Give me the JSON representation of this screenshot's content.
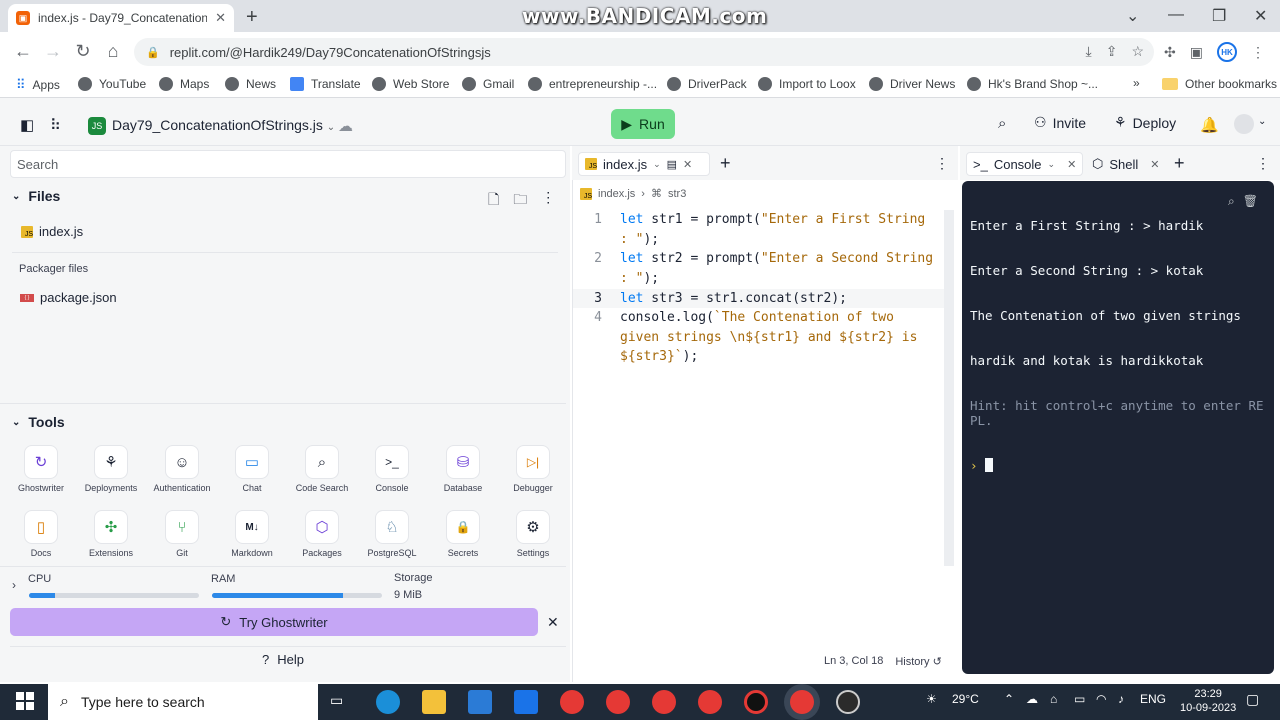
{
  "browser": {
    "tab_title": "index.js - Day79_ConcatenationO",
    "url": "replit.com/@Hardik249/Day79ConcatenationOfStringsjs",
    "watermark": "www.BANDICAM.com",
    "avatar_initials": "HK",
    "bookmarks": [
      {
        "label": "Apps",
        "icon": "apps-grid-icon"
      },
      {
        "label": "YouTube",
        "icon": "globe-icon"
      },
      {
        "label": "Maps",
        "icon": "globe-icon"
      },
      {
        "label": "News",
        "icon": "globe-icon"
      },
      {
        "label": "Translate",
        "icon": "translate-icon"
      },
      {
        "label": "Web Store",
        "icon": "globe-icon"
      },
      {
        "label": "Gmail",
        "icon": "globe-icon"
      },
      {
        "label": "entrepreneurship -...",
        "icon": "globe-icon"
      },
      {
        "label": "DriverPack",
        "icon": "globe-icon"
      },
      {
        "label": "Import to Loox",
        "icon": "globe-icon"
      },
      {
        "label": "Driver News",
        "icon": "globe-icon"
      },
      {
        "label": "Hk's Brand Shop ~...",
        "icon": "globe-icon"
      }
    ],
    "more_bookmarks": "»",
    "other_bookmarks": "Other bookmarks"
  },
  "replit": {
    "repl_name": "Day79_ConcatenationOfStrings.js",
    "run_label": "Run",
    "invite_label": "Invite",
    "deploy_label": "Deploy",
    "search_placeholder": "Search",
    "files_heading": "Files",
    "files": [
      "index.js"
    ],
    "packager_heading": "Packager files",
    "packager_files": [
      "package.json"
    ],
    "tools_heading": "Tools",
    "tools": [
      {
        "label": "Ghostwriter",
        "glyph": "↻"
      },
      {
        "label": "Deployments",
        "glyph": "⚘"
      },
      {
        "label": "Authentication",
        "glyph": "☺"
      },
      {
        "label": "Chat",
        "glyph": "▭"
      },
      {
        "label": "Code Search",
        "glyph": "⌕"
      },
      {
        "label": "Console",
        "glyph": ">_"
      },
      {
        "label": "Database",
        "glyph": "⛁"
      },
      {
        "label": "Debugger",
        "glyph": "▷|"
      },
      {
        "label": "Docs",
        "glyph": "▯"
      },
      {
        "label": "Extensions",
        "glyph": "✣"
      },
      {
        "label": "Git",
        "glyph": "⑂"
      },
      {
        "label": "Markdown",
        "glyph": "M↓"
      },
      {
        "label": "Packages",
        "glyph": "⬡"
      },
      {
        "label": "PostgreSQL",
        "glyph": "♘"
      },
      {
        "label": "Secrets",
        "glyph": "🔒"
      },
      {
        "label": "Settings",
        "glyph": "⚙"
      }
    ],
    "resources": {
      "cpu_label": "CPU",
      "cpu_usage": 0.15,
      "ram_label": "RAM",
      "ram_usage": 0.77,
      "storage_label": "Storage",
      "storage_value": "9 MiB"
    },
    "ghostwriter_button": "Try Ghostwriter",
    "help_label": "Help"
  },
  "editor": {
    "tab_label": "index.js",
    "breadcrumb_file": "index.js",
    "breadcrumb_symbol": "str3",
    "lines": [
      {
        "num": "1",
        "kw": "let",
        "rest": " str1 = prompt(",
        "str": "\"Enter a First String : \"",
        "end": ");"
      },
      {
        "num": "2",
        "kw": "let",
        "rest": " str2 = prompt(",
        "str": "\"Enter a Second String : \"",
        "end": ");"
      },
      {
        "num": "3",
        "kw": "let",
        "rest": " str3 = str1.concat(str2);",
        "str": "",
        "end": ""
      },
      {
        "num": "4",
        "kw": "",
        "rest": "console.log(",
        "str": "`The Contenation of two given strings \\n${str1} and ${str2} is ${str3}`",
        "end": ");"
      }
    ],
    "cursor_position": "Ln 3, Col 18",
    "history_label": "History"
  },
  "console": {
    "tab_console": "Console",
    "tab_shell": "Shell",
    "output": [
      "Enter a First String : > hardik",
      "Enter a Second String : > kotak",
      "The Contenation of two given strings",
      "hardik and kotak is hardikkotak"
    ],
    "hint": "Hint: hit control+c anytime to enter REPL.",
    "prompt_symbol": "›"
  },
  "taskbar": {
    "search_placeholder": "Type here to search",
    "temperature": "29°C",
    "language": "ENG",
    "time": "23:29",
    "date": "10-09-2023"
  }
}
